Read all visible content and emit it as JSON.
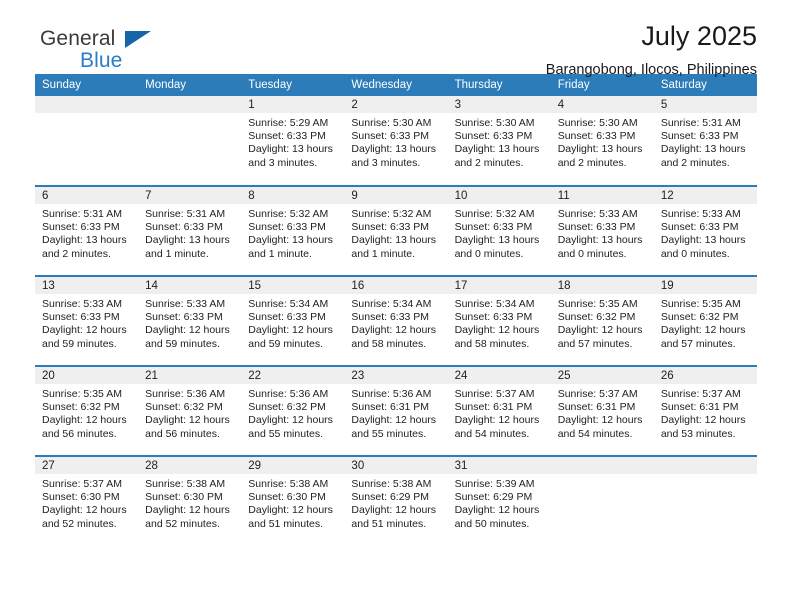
{
  "brand": {
    "name_top": "General",
    "name_bottom": "Blue",
    "triangle_color": "#1565a8",
    "bottom_color": "#2a7cc7"
  },
  "header": {
    "title": "July 2025",
    "subtitle": "Barangobong, Ilocos, Philippines"
  },
  "theme": {
    "header_blue": "#2b7cb9",
    "daynum_gray": "#efefef",
    "text": "#222222"
  },
  "weekday_headers": [
    "Sunday",
    "Monday",
    "Tuesday",
    "Wednesday",
    "Thursday",
    "Friday",
    "Saturday"
  ],
  "labels": {
    "sunrise": "Sunrise:",
    "sunset": "Sunset:",
    "daylight": "Daylight:"
  },
  "weeks": [
    [
      {
        "day": "",
        "sunrise": "",
        "sunset": "",
        "daylight_1": "",
        "daylight_2": ""
      },
      {
        "day": "",
        "sunrise": "",
        "sunset": "",
        "daylight_1": "",
        "daylight_2": ""
      },
      {
        "day": "1",
        "sunrise": "Sunrise: 5:29 AM",
        "sunset": "Sunset: 6:33 PM",
        "daylight_1": "Daylight: 13 hours",
        "daylight_2": "and 3 minutes."
      },
      {
        "day": "2",
        "sunrise": "Sunrise: 5:30 AM",
        "sunset": "Sunset: 6:33 PM",
        "daylight_1": "Daylight: 13 hours",
        "daylight_2": "and 3 minutes."
      },
      {
        "day": "3",
        "sunrise": "Sunrise: 5:30 AM",
        "sunset": "Sunset: 6:33 PM",
        "daylight_1": "Daylight: 13 hours",
        "daylight_2": "and 2 minutes."
      },
      {
        "day": "4",
        "sunrise": "Sunrise: 5:30 AM",
        "sunset": "Sunset: 6:33 PM",
        "daylight_1": "Daylight: 13 hours",
        "daylight_2": "and 2 minutes."
      },
      {
        "day": "5",
        "sunrise": "Sunrise: 5:31 AM",
        "sunset": "Sunset: 6:33 PM",
        "daylight_1": "Daylight: 13 hours",
        "daylight_2": "and 2 minutes."
      }
    ],
    [
      {
        "day": "6",
        "sunrise": "Sunrise: 5:31 AM",
        "sunset": "Sunset: 6:33 PM",
        "daylight_1": "Daylight: 13 hours",
        "daylight_2": "and 2 minutes."
      },
      {
        "day": "7",
        "sunrise": "Sunrise: 5:31 AM",
        "sunset": "Sunset: 6:33 PM",
        "daylight_1": "Daylight: 13 hours",
        "daylight_2": "and 1 minute."
      },
      {
        "day": "8",
        "sunrise": "Sunrise: 5:32 AM",
        "sunset": "Sunset: 6:33 PM",
        "daylight_1": "Daylight: 13 hours",
        "daylight_2": "and 1 minute."
      },
      {
        "day": "9",
        "sunrise": "Sunrise: 5:32 AM",
        "sunset": "Sunset: 6:33 PM",
        "daylight_1": "Daylight: 13 hours",
        "daylight_2": "and 1 minute."
      },
      {
        "day": "10",
        "sunrise": "Sunrise: 5:32 AM",
        "sunset": "Sunset: 6:33 PM",
        "daylight_1": "Daylight: 13 hours",
        "daylight_2": "and 0 minutes."
      },
      {
        "day": "11",
        "sunrise": "Sunrise: 5:33 AM",
        "sunset": "Sunset: 6:33 PM",
        "daylight_1": "Daylight: 13 hours",
        "daylight_2": "and 0 minutes."
      },
      {
        "day": "12",
        "sunrise": "Sunrise: 5:33 AM",
        "sunset": "Sunset: 6:33 PM",
        "daylight_1": "Daylight: 13 hours",
        "daylight_2": "and 0 minutes."
      }
    ],
    [
      {
        "day": "13",
        "sunrise": "Sunrise: 5:33 AM",
        "sunset": "Sunset: 6:33 PM",
        "daylight_1": "Daylight: 12 hours",
        "daylight_2": "and 59 minutes."
      },
      {
        "day": "14",
        "sunrise": "Sunrise: 5:33 AM",
        "sunset": "Sunset: 6:33 PM",
        "daylight_1": "Daylight: 12 hours",
        "daylight_2": "and 59 minutes."
      },
      {
        "day": "15",
        "sunrise": "Sunrise: 5:34 AM",
        "sunset": "Sunset: 6:33 PM",
        "daylight_1": "Daylight: 12 hours",
        "daylight_2": "and 59 minutes."
      },
      {
        "day": "16",
        "sunrise": "Sunrise: 5:34 AM",
        "sunset": "Sunset: 6:33 PM",
        "daylight_1": "Daylight: 12 hours",
        "daylight_2": "and 58 minutes."
      },
      {
        "day": "17",
        "sunrise": "Sunrise: 5:34 AM",
        "sunset": "Sunset: 6:33 PM",
        "daylight_1": "Daylight: 12 hours",
        "daylight_2": "and 58 minutes."
      },
      {
        "day": "18",
        "sunrise": "Sunrise: 5:35 AM",
        "sunset": "Sunset: 6:32 PM",
        "daylight_1": "Daylight: 12 hours",
        "daylight_2": "and 57 minutes."
      },
      {
        "day": "19",
        "sunrise": "Sunrise: 5:35 AM",
        "sunset": "Sunset: 6:32 PM",
        "daylight_1": "Daylight: 12 hours",
        "daylight_2": "and 57 minutes."
      }
    ],
    [
      {
        "day": "20",
        "sunrise": "Sunrise: 5:35 AM",
        "sunset": "Sunset: 6:32 PM",
        "daylight_1": "Daylight: 12 hours",
        "daylight_2": "and 56 minutes."
      },
      {
        "day": "21",
        "sunrise": "Sunrise: 5:36 AM",
        "sunset": "Sunset: 6:32 PM",
        "daylight_1": "Daylight: 12 hours",
        "daylight_2": "and 56 minutes."
      },
      {
        "day": "22",
        "sunrise": "Sunrise: 5:36 AM",
        "sunset": "Sunset: 6:32 PM",
        "daylight_1": "Daylight: 12 hours",
        "daylight_2": "and 55 minutes."
      },
      {
        "day": "23",
        "sunrise": "Sunrise: 5:36 AM",
        "sunset": "Sunset: 6:31 PM",
        "daylight_1": "Daylight: 12 hours",
        "daylight_2": "and 55 minutes."
      },
      {
        "day": "24",
        "sunrise": "Sunrise: 5:37 AM",
        "sunset": "Sunset: 6:31 PM",
        "daylight_1": "Daylight: 12 hours",
        "daylight_2": "and 54 minutes."
      },
      {
        "day": "25",
        "sunrise": "Sunrise: 5:37 AM",
        "sunset": "Sunset: 6:31 PM",
        "daylight_1": "Daylight: 12 hours",
        "daylight_2": "and 54 minutes."
      },
      {
        "day": "26",
        "sunrise": "Sunrise: 5:37 AM",
        "sunset": "Sunset: 6:31 PM",
        "daylight_1": "Daylight: 12 hours",
        "daylight_2": "and 53 minutes."
      }
    ],
    [
      {
        "day": "27",
        "sunrise": "Sunrise: 5:37 AM",
        "sunset": "Sunset: 6:30 PM",
        "daylight_1": "Daylight: 12 hours",
        "daylight_2": "and 52 minutes."
      },
      {
        "day": "28",
        "sunrise": "Sunrise: 5:38 AM",
        "sunset": "Sunset: 6:30 PM",
        "daylight_1": "Daylight: 12 hours",
        "daylight_2": "and 52 minutes."
      },
      {
        "day": "29",
        "sunrise": "Sunrise: 5:38 AM",
        "sunset": "Sunset: 6:30 PM",
        "daylight_1": "Daylight: 12 hours",
        "daylight_2": "and 51 minutes."
      },
      {
        "day": "30",
        "sunrise": "Sunrise: 5:38 AM",
        "sunset": "Sunset: 6:29 PM",
        "daylight_1": "Daylight: 12 hours",
        "daylight_2": "and 51 minutes."
      },
      {
        "day": "31",
        "sunrise": "Sunrise: 5:39 AM",
        "sunset": "Sunset: 6:29 PM",
        "daylight_1": "Daylight: 12 hours",
        "daylight_2": "and 50 minutes."
      },
      {
        "day": "",
        "sunrise": "",
        "sunset": "",
        "daylight_1": "",
        "daylight_2": ""
      },
      {
        "day": "",
        "sunrise": "",
        "sunset": "",
        "daylight_1": "",
        "daylight_2": ""
      }
    ]
  ]
}
